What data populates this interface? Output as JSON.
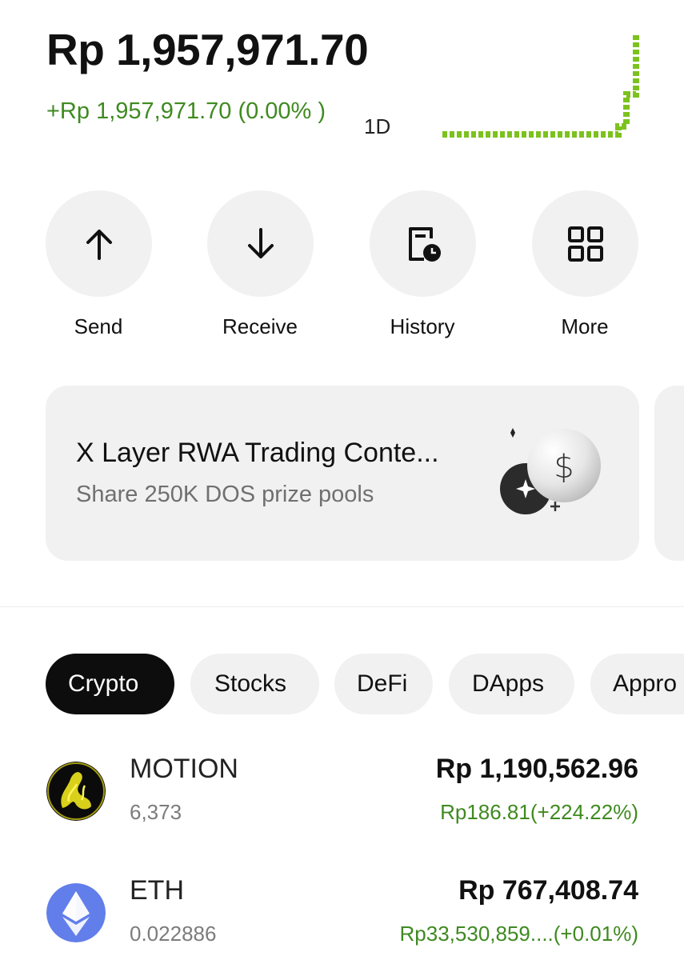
{
  "header": {
    "balance": "Rp 1,957,971.70",
    "change": "+Rp 1,957,971.70 (0.00% )",
    "period": "1D",
    "accent_color": "#3f8a20",
    "chart_color": "#7cc21e"
  },
  "actions": [
    {
      "label": "Send",
      "icon": "arrow-up-icon"
    },
    {
      "label": "Receive",
      "icon": "arrow-down-icon"
    },
    {
      "label": "History",
      "icon": "history-clock-icon"
    },
    {
      "label": "More",
      "icon": "grid-icon"
    }
  ],
  "banner": {
    "title": "X Layer RWA Trading Conte...",
    "subtitle": "Share 250K DOS prize pools",
    "icon": "dollar-coin-icon"
  },
  "tabs": [
    "Crypto",
    "Stocks",
    "DeFi",
    "DApps",
    "Appro"
  ],
  "active_tab": "Crypto",
  "assets": [
    {
      "name": "MOTION",
      "qty": "6,373",
      "value": "Rp 1,190,562.96",
      "pnl": "Rp186.81(+224.22%)",
      "icon": "motion-token-icon"
    },
    {
      "name": "ETH",
      "qty": "0.022886",
      "value": "Rp 767,408.74",
      "pnl": "Rp33,530,859....(+0.01%)",
      "icon": "ethereum-icon"
    }
  ]
}
